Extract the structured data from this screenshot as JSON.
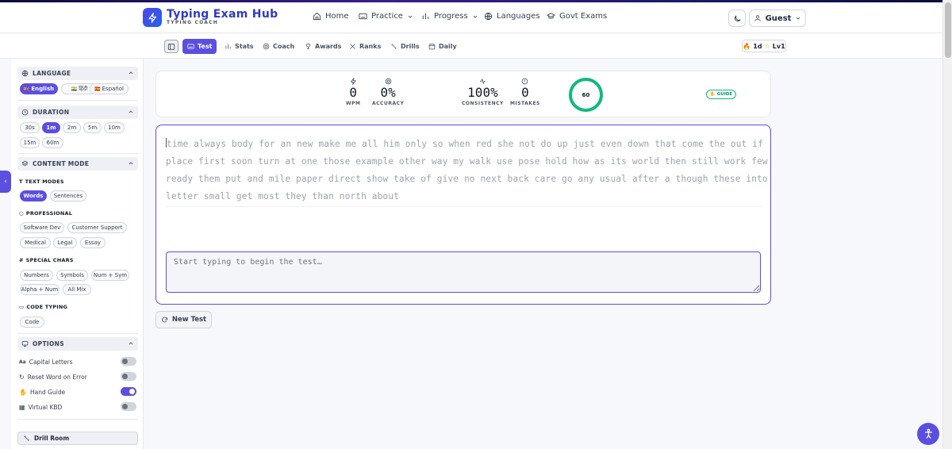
{
  "header": {
    "brand": "Typing Exam Hub",
    "brand_sub": "TYPING COACH",
    "nav": [
      {
        "label": "Home",
        "icon": "home-icon"
      },
      {
        "label": "Practice",
        "icon": "keyboard-icon"
      },
      {
        "label": "Progress",
        "icon": "bar-chart-icon"
      },
      {
        "label": "Languages",
        "icon": "globe-icon"
      },
      {
        "label": "Govt Exams",
        "icon": "graduation-cap-icon"
      }
    ],
    "user_label": "Guest"
  },
  "tabs": [
    {
      "label": "Test",
      "active": true
    },
    {
      "label": "Stats"
    },
    {
      "label": "Coach"
    },
    {
      "label": "Awards"
    },
    {
      "label": "Ranks"
    },
    {
      "label": "Drills"
    },
    {
      "label": "Daily"
    }
  ],
  "streak": {
    "days": "1d",
    "level": "Lv1"
  },
  "sidebar": {
    "language": {
      "title": "LANGUAGE",
      "options": [
        {
          "flag": "🇬🇧",
          "label": "English",
          "active": true
        },
        {
          "flag": "🇮🇳",
          "label": "हिंदी"
        },
        {
          "flag": "🇪🇸",
          "label": "Español"
        }
      ]
    },
    "duration": {
      "title": "DURATION",
      "options": [
        "30s",
        "1m",
        "2m",
        "5m",
        "10m",
        "15m",
        "60m"
      ],
      "selected": "1m"
    },
    "content_mode": {
      "title": "CONTENT MODE",
      "text_modes_label": "TEXT MODES",
      "text_modes": [
        "Words",
        "Sentences"
      ],
      "professional_label": "PROFESSIONAL",
      "professional": [
        "Software Dev",
        "Customer Support",
        "Medical",
        "Legal",
        "Essay"
      ],
      "special_label": "SPECIAL CHARS",
      "special": [
        "Numbers",
        "Symbols",
        "Num + Sym",
        "Alpha + Num",
        "All Mix"
      ],
      "code_label": "CODE TYPING",
      "code": [
        "Code"
      ]
    },
    "options": {
      "title": "OPTIONS",
      "items": [
        {
          "label": "Capital Letters",
          "on": false
        },
        {
          "label": "Reset Word on Error",
          "on": false
        },
        {
          "label": "Hand Guide",
          "on": true
        },
        {
          "label": "Virtual KBD",
          "on": false
        }
      ]
    },
    "drill_room": "Drill Room"
  },
  "stats": {
    "wpm": {
      "value": "0",
      "label": "WPM"
    },
    "accuracy": {
      "value": "0%",
      "label": "ACCURACY"
    },
    "timer": "60",
    "consistency": {
      "value": "100%",
      "label": "CONSISTENCY"
    },
    "mistakes": {
      "value": "0",
      "label": "MISTAKES"
    },
    "guide": "GUIDE"
  },
  "passage": {
    "first_char": "t",
    "rest": "ime always body for an new make me all him only so when red she not do up just even down that come the out if place first soon turn at one those example other way my walk use pose hold how as its world then still work few ready them put and mile paper direct show take of give no next back care go any usual after a though these into letter small get most they than north about"
  },
  "input": {
    "placeholder": "Start typing to begin the test…"
  },
  "new_test_label": "New Test",
  "colors": {
    "accent": "#5b4fe0",
    "success": "#10b981",
    "brand": "#2f3bbf"
  }
}
